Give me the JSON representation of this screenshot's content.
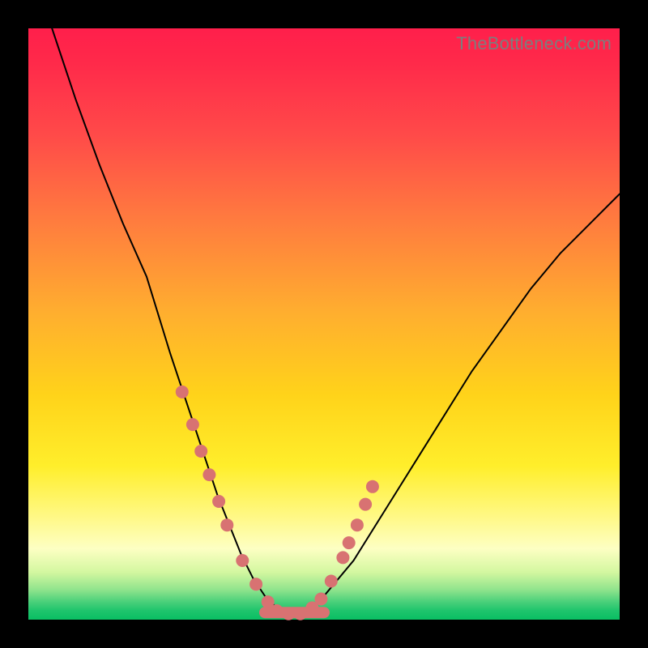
{
  "watermark": "TheBottleneck.com",
  "colors": {
    "marker": "#d87272",
    "curve": "#000000",
    "gradient_top": "#ff1f4b",
    "gradient_bottom": "#0abf63"
  },
  "chart_data": {
    "type": "line",
    "title": "",
    "xlabel": "",
    "ylabel": "",
    "xlim": [
      0,
      100
    ],
    "ylim": [
      0,
      100
    ],
    "grid": false,
    "legend": false,
    "annotations": [
      "TheBottleneck.com"
    ],
    "series": [
      {
        "name": "bottleneck-curve",
        "x": [
          4,
          8,
          12,
          16,
          20,
          24,
          26,
          28,
          30,
          32,
          34,
          36,
          38,
          40,
          42,
          44,
          46,
          48,
          50,
          55,
          60,
          65,
          70,
          75,
          80,
          85,
          90,
          95,
          100
        ],
        "y": [
          100,
          88,
          77,
          67,
          58,
          45,
          39,
          33,
          27,
          21,
          16,
          11,
          7,
          4,
          2,
          1,
          1,
          2,
          4,
          10,
          18,
          26,
          34,
          42,
          49,
          56,
          62,
          67,
          72
        ]
      }
    ],
    "markers": {
      "name": "highlighted-points",
      "x": [
        26.0,
        27.8,
        29.2,
        30.6,
        32.2,
        33.6,
        36.2,
        38.5,
        40.5,
        42.0,
        44.0,
        46.0,
        48.0,
        49.5,
        51.2,
        53.2,
        54.2,
        55.6,
        57.0,
        58.2
      ],
      "y": [
        38.5,
        33.0,
        28.5,
        24.5,
        20.0,
        16.0,
        10.0,
        6.0,
        3.0,
        1.5,
        1.0,
        1.0,
        2.0,
        3.5,
        6.5,
        10.5,
        13.0,
        16.0,
        19.5,
        22.5
      ]
    }
  }
}
